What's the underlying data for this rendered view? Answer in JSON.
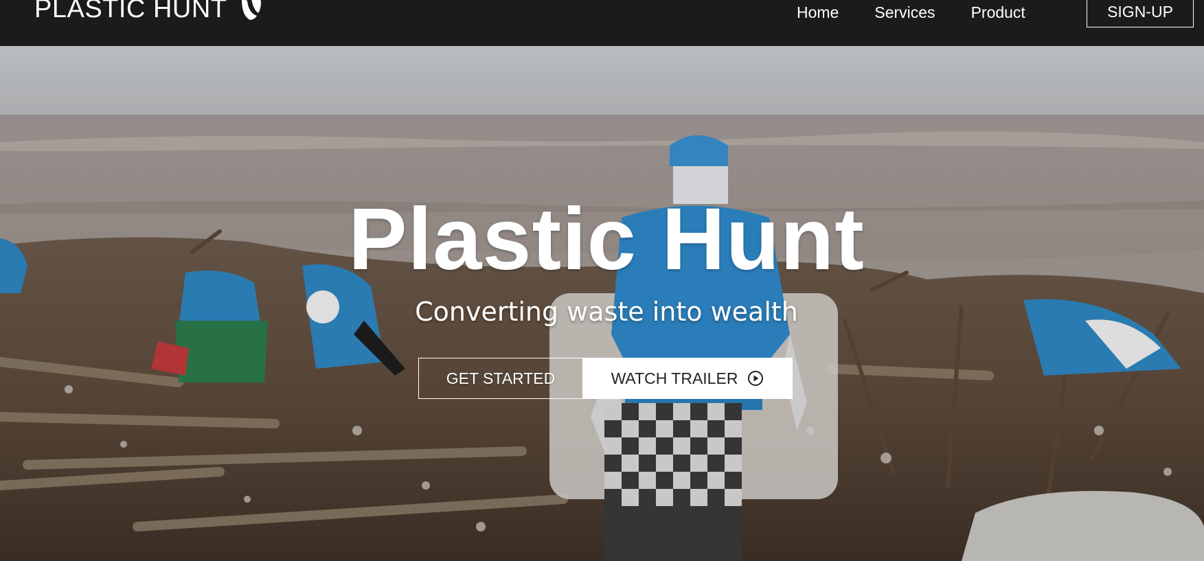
{
  "navbar": {
    "brand": "PLASTIC HUNT",
    "brand_icon": "typo3-logo-icon",
    "links": [
      {
        "label": "Home"
      },
      {
        "label": "Services"
      },
      {
        "label": "Product"
      }
    ],
    "signup_label": "SIGN-UP"
  },
  "hero": {
    "title": "Plastic Hunt",
    "subtitle": "Converting waste into wealth",
    "get_started_label": "GET STARTED",
    "watch_trailer_label": "WATCH TRAILER",
    "watch_trailer_icon": "play-circle-icon",
    "background": "photo of volunteers collecting plastic waste on a beach"
  },
  "colors": {
    "navbar_bg": "#1b1b1b",
    "text_light": "#ffffff",
    "button_dark_text": "#222222"
  }
}
